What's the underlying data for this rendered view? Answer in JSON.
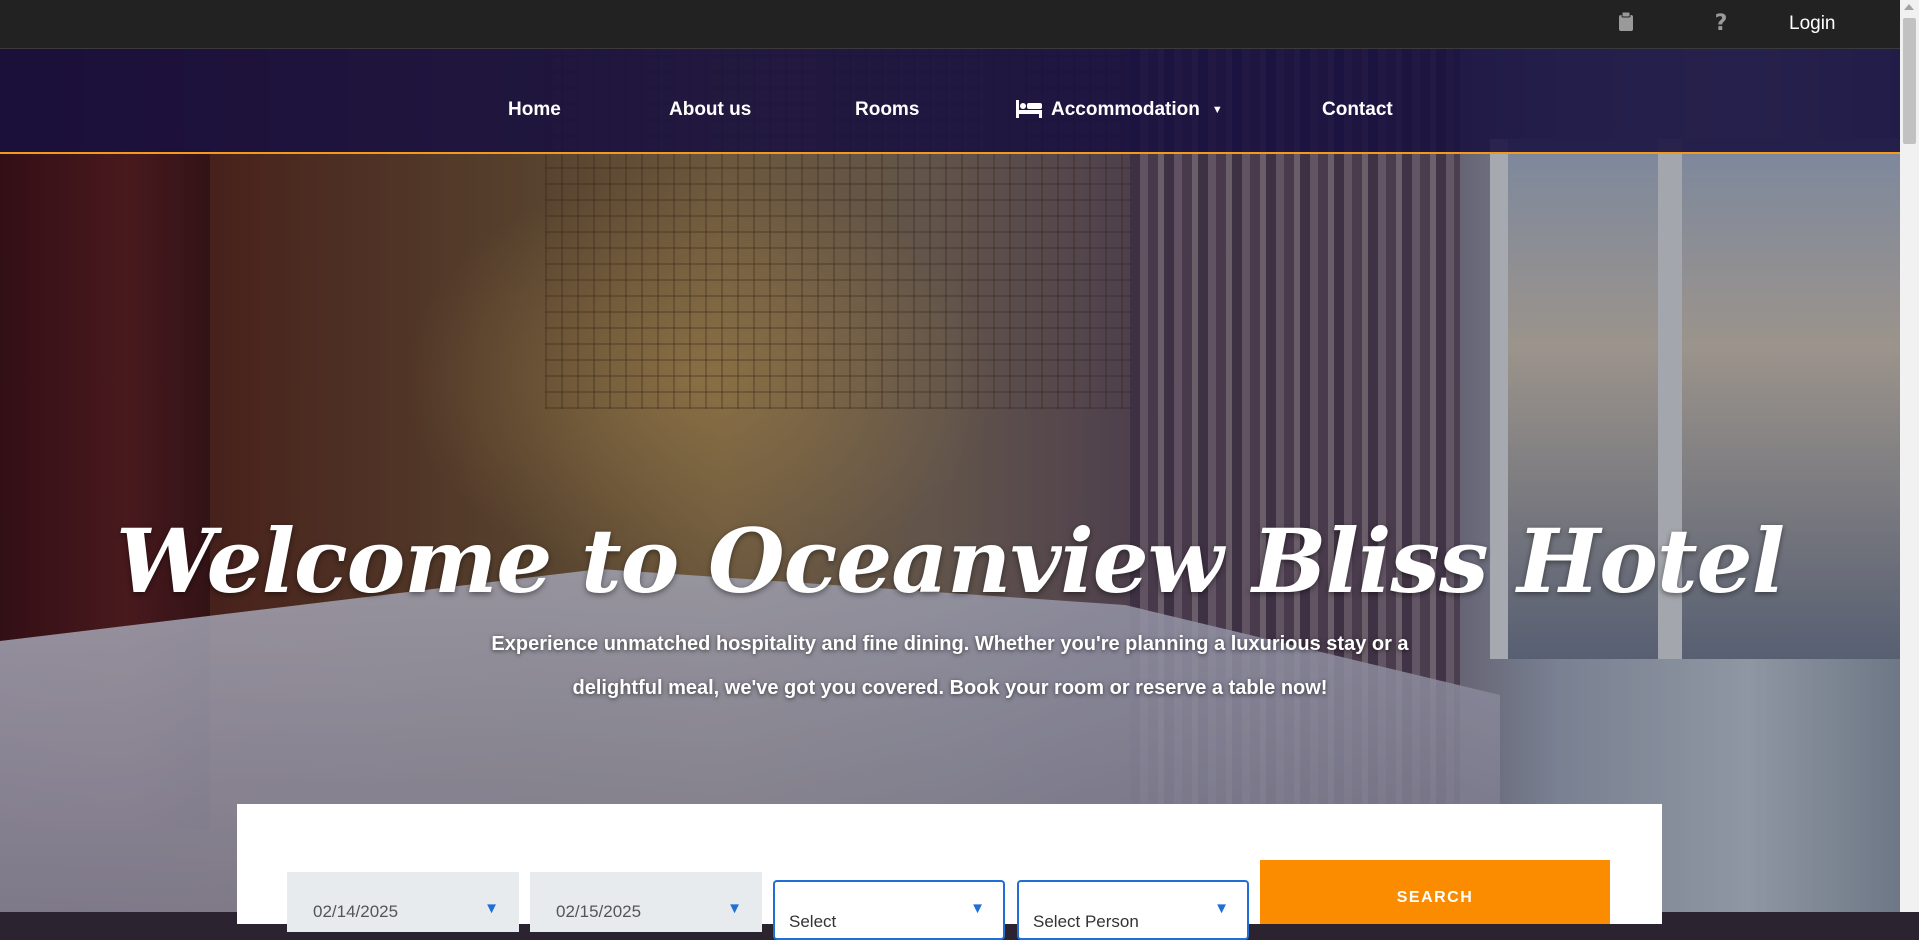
{
  "topbar": {
    "icons": [
      "clipboard-icon",
      "question-mark-icon"
    ],
    "help_glyph": "?",
    "login_label": "Login"
  },
  "nav": {
    "items": [
      {
        "label": "Home"
      },
      {
        "label": "About us"
      },
      {
        "label": "Rooms"
      },
      {
        "label": "Accommodation",
        "icon": "bed-icon",
        "has_dropdown": true
      },
      {
        "label": "Contact"
      }
    ],
    "accent_color": "#f39a1c"
  },
  "hero": {
    "title": "Welcome to Oceanview Bliss Hotel",
    "subtitle": "Experience unmatched hospitality and fine dining. Whether you're planning a luxurious stay or a delightful meal, we've got you covered. Book your room or reserve a table now!"
  },
  "booking": {
    "checkin_value": "02/14/2025",
    "checkout_value": "02/15/2025",
    "room_select": "Select",
    "person_select": "Select Person",
    "search_label": "SEARCH",
    "button_color": "#fb8c00"
  }
}
